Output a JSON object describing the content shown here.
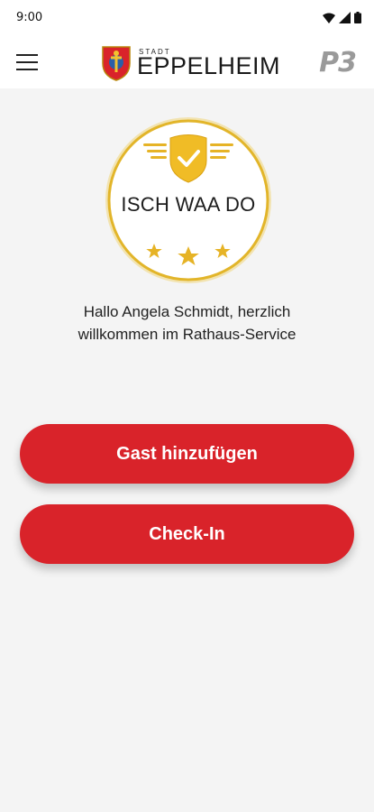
{
  "status": {
    "time": "9:00"
  },
  "header": {
    "brand_prefix": "STADT",
    "brand_name": "EPPELHEIM",
    "partner_logo": "P3"
  },
  "badge": {
    "title": "ISCH WAA DO"
  },
  "greeting": {
    "line1": "Hallo Angela Schmidt, herzlich",
    "line2": "willkommen im Rathaus-Service"
  },
  "actions": {
    "add_guest": "Gast hinzufügen",
    "check_in": "Check-In"
  },
  "colors": {
    "accent": "#d9232a",
    "gold": "#e2b52a",
    "background": "#f4f4f4"
  }
}
